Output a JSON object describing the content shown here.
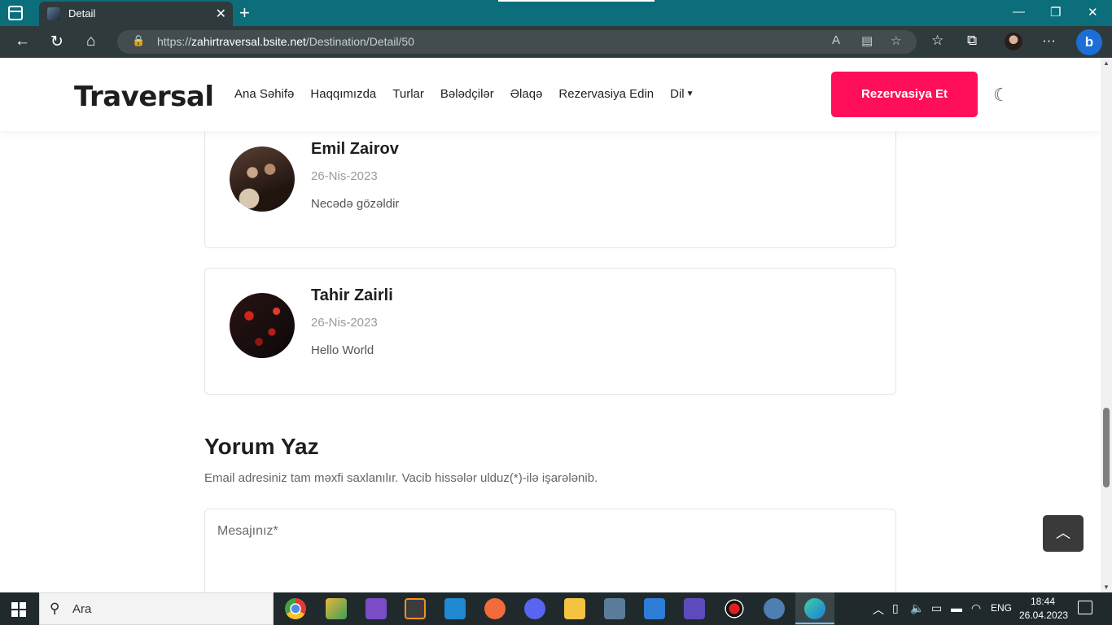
{
  "browser": {
    "tab_title": "Detail",
    "url_prefix": "https://",
    "url_host": "zahirtraversal.bsite.net",
    "url_path": "/Destination/Detail/50"
  },
  "site": {
    "logo": "Traversal",
    "nav": [
      "Ana Səhifə",
      "Haqqımızda",
      "Turlar",
      "Bələdçilər",
      "Əlaqə",
      "Rezervasiya Edin",
      "Dil"
    ],
    "reserve_button": "Rezervasiya Et"
  },
  "comments": [
    {
      "name": "Emil Zairov",
      "date": "26-Nis-2023",
      "text": "Necədə gözəldir"
    },
    {
      "name": "Tahir Zairli",
      "date": "26-Nis-2023",
      "text": "Hello World"
    }
  ],
  "write_comment": {
    "title": "Yorum Yaz",
    "note": "Email adresiniz tam məxfi saxlanılır. Vacib hissələr ulduz(*)-ilə işarələnib.",
    "message_placeholder": "Mesajınız*"
  },
  "taskbar": {
    "search_placeholder": "Ara",
    "language": "ENG",
    "time": "18:44",
    "date": "26.04.2023"
  },
  "colors": {
    "accent": "#ff0f59",
    "tabbar": "#0b6e7a"
  }
}
